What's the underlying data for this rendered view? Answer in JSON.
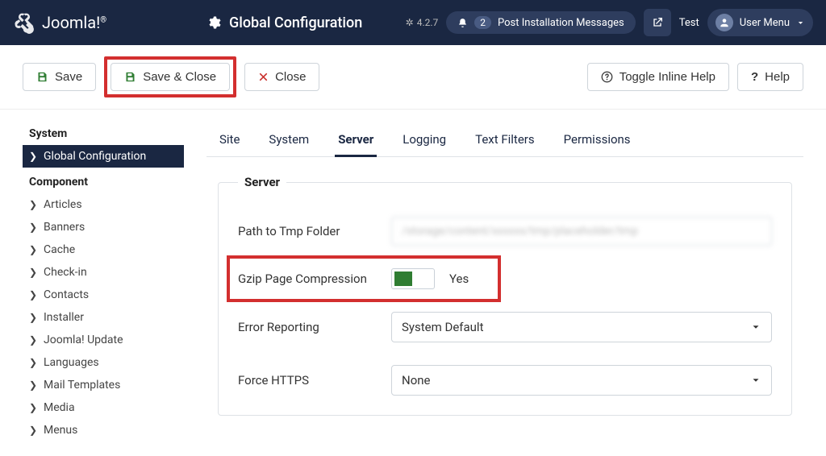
{
  "header": {
    "brand": "Joomla!",
    "page_title": "Global Configuration",
    "version": "4.2.7",
    "notif_count": "2",
    "notif_label": "Post Installation Messages",
    "test_label": "Test",
    "user_menu_label": "User Menu"
  },
  "toolbar": {
    "save": "Save",
    "save_close": "Save & Close",
    "close": "Close",
    "toggle_help": "Toggle Inline Help",
    "help": "Help"
  },
  "sidebar": {
    "heading_system": "System",
    "heading_component": "Component",
    "active": "Global Configuration",
    "items": [
      "Articles",
      "Banners",
      "Cache",
      "Check-in",
      "Contacts",
      "Installer",
      "Joomla! Update",
      "Languages",
      "Mail Templates",
      "Media",
      "Menus"
    ]
  },
  "tabs": [
    "Site",
    "System",
    "Server",
    "Logging",
    "Text Filters",
    "Permissions"
  ],
  "active_tab": "Server",
  "panel": {
    "legend": "Server",
    "path_label": "Path to Tmp Folder",
    "path_value": "/storage/content/xxxxxx/tmp/placeholder/tmp",
    "gzip_label": "Gzip Page Compression",
    "gzip_value": "Yes",
    "error_label": "Error Reporting",
    "error_value": "System Default",
    "https_label": "Force HTTPS",
    "https_value": "None"
  }
}
